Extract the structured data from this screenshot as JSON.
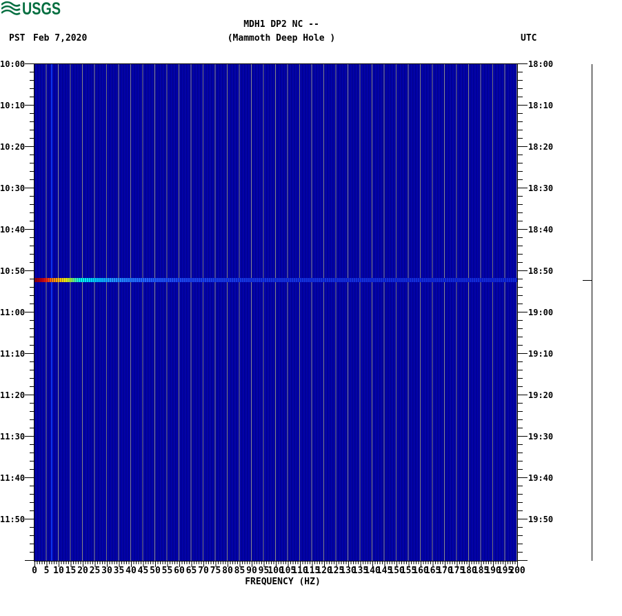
{
  "logo": {
    "org": "USGS",
    "color": "#066f41"
  },
  "header": {
    "title": "MDH1 DP2 NC --",
    "subtitle": "(Mammoth Deep Hole )",
    "left_timezone": "PST",
    "date": "Feb 7,2020",
    "right_timezone": "UTC"
  },
  "axes": {
    "left_times": [
      "10:00",
      "10:10",
      "10:20",
      "10:30",
      "10:40",
      "10:50",
      "11:00",
      "11:10",
      "11:20",
      "11:30",
      "11:40",
      "11:50"
    ],
    "right_times": [
      "18:00",
      "18:10",
      "18:20",
      "18:30",
      "18:40",
      "18:50",
      "19:00",
      "19:10",
      "19:20",
      "19:30",
      "19:40",
      "19:50"
    ],
    "freq_labels": [
      "0",
      "5",
      "10",
      "15",
      "20",
      "25",
      "30",
      "35",
      "40",
      "45",
      "50",
      "55",
      "60",
      "65",
      "70",
      "75",
      "80",
      "85",
      "90",
      "95",
      "100",
      "105",
      "110",
      "115",
      "120",
      "125",
      "130",
      "135",
      "140",
      "145",
      "150",
      "155",
      "160",
      "165",
      "170",
      "175",
      "180",
      "185",
      "190",
      "195",
      "200"
    ],
    "xlabel": "FREQUENCY (HZ)"
  },
  "chart_data": {
    "type": "heatmap",
    "title": "MDH1 DP2 NC --",
    "subtitle": "(Mammoth Deep Hole )",
    "station": "MDH1",
    "channel": "DP2",
    "network": "NC",
    "xlabel": "FREQUENCY (HZ)",
    "x_range_hz": [
      0,
      200
    ],
    "x_label_step_hz": 5,
    "x_minor_tick_hz": 1,
    "time_axis": {
      "date": "Feb 7,2020",
      "left_timezone": "PST",
      "right_timezone": "UTC",
      "start_pst": "10:00",
      "end_pst": "12:00",
      "start_utc": "18:00",
      "end_utc": "20:00",
      "label_interval_min": 10,
      "minor_tick_min": 2
    },
    "background_value_color": "#0000a6",
    "gridline_color": "#8a8a8a",
    "gridline_step_hz": 5,
    "persistent_tone": {
      "frequency_hz": 7,
      "color": "#1040ff"
    },
    "events": [
      {
        "time_pst": "10:52",
        "time_utc": "18:52",
        "description": "broadband seismic event; energy strongest below 20 Hz, decaying toward 200 Hz",
        "spectrum_color_stops": [
          {
            "hz": 0,
            "color": "#880000"
          },
          {
            "hz": 3,
            "color": "#cc0000"
          },
          {
            "hz": 5,
            "color": "#ff2200"
          },
          {
            "hz": 7,
            "color": "#ff7700"
          },
          {
            "hz": 11,
            "color": "#ffcc00"
          },
          {
            "hz": 13,
            "color": "#ffff00"
          },
          {
            "hz": 15,
            "color": "#aaff33"
          },
          {
            "hz": 17,
            "color": "#44ffaa"
          },
          {
            "hz": 19,
            "color": "#00ffee"
          },
          {
            "hz": 26,
            "color": "#00ccff"
          },
          {
            "hz": 32,
            "color": "#2299ff"
          },
          {
            "hz": 45,
            "color": "#2266ff"
          },
          {
            "hz": 60,
            "color": "#1c47f0"
          },
          {
            "hz": 90,
            "color": "#1535e2"
          },
          {
            "hz": 200,
            "color": "#1128d8"
          }
        ]
      }
    ],
    "right_marker_bar": {
      "tick_time_utc": "18:52",
      "tick_time_pst": "10:52"
    }
  }
}
